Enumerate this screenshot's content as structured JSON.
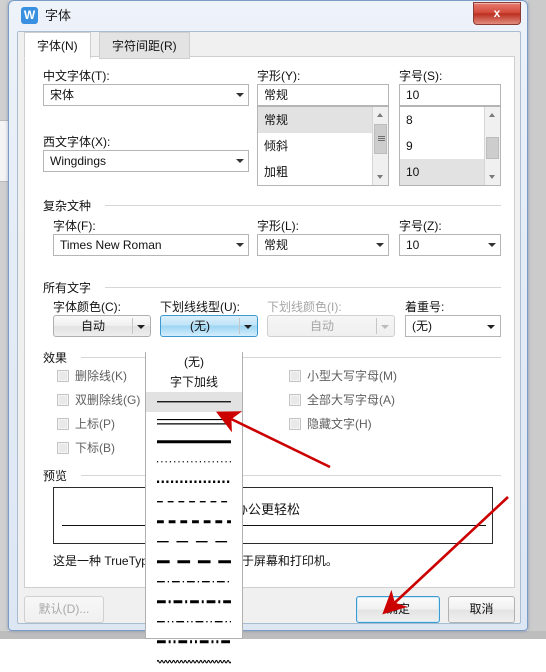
{
  "window": {
    "title": "字体",
    "icon": "wps-w-icon",
    "close_label": "x"
  },
  "tabs": [
    {
      "label": "字体(N)",
      "active": true
    },
    {
      "label": "字符间距(R)",
      "active": false
    }
  ],
  "latin_section": {
    "chinese_font": {
      "label": "中文字体(T):",
      "value": "宋体"
    },
    "western_font": {
      "label": "西文字体(X):",
      "value": "Wingdings"
    },
    "style": {
      "label": "字形(Y):",
      "value": "常规",
      "options": [
        "常规",
        "倾斜",
        "加粗"
      ],
      "selected": "常规"
    },
    "size": {
      "label": "字号(S):",
      "value": "10",
      "options": [
        "8",
        "9",
        "10"
      ],
      "selected": "10"
    }
  },
  "complex_section": {
    "title": "复杂文种",
    "font": {
      "label": "字体(F):",
      "value": "Times New Roman"
    },
    "style": {
      "label": "字形(L):",
      "value": "常规"
    },
    "size": {
      "label": "字号(Z):",
      "value": "10"
    }
  },
  "all_text_section": {
    "title": "所有文字",
    "font_color": {
      "label": "字体颜色(C):",
      "value": "自动",
      "disabled": false
    },
    "underline_style": {
      "label": "下划线线型(U):",
      "value": "(无)",
      "disabled": false,
      "active": true
    },
    "underline_color": {
      "label": "下划线颜色(I):",
      "value": "自动",
      "disabled": true
    },
    "emphasis_mark": {
      "label": "着重号:",
      "value": "(无)",
      "disabled": false
    }
  },
  "underline_dropdown": {
    "items": [
      {
        "kind": "text",
        "label": "(无)",
        "selected": false
      },
      {
        "kind": "text",
        "label": "字下加线",
        "selected": false
      },
      {
        "kind": "line",
        "style": "single",
        "selected": true
      },
      {
        "kind": "line",
        "style": "double",
        "selected": false
      },
      {
        "kind": "line",
        "style": "thick",
        "selected": false
      },
      {
        "kind": "line",
        "style": "dotted",
        "selected": false
      },
      {
        "kind": "line",
        "style": "dotted-thick",
        "selected": false
      },
      {
        "kind": "line",
        "style": "dashed",
        "selected": false
      },
      {
        "kind": "line",
        "style": "dashed-thick",
        "selected": false
      },
      {
        "kind": "line",
        "style": "long-dash",
        "selected": false
      },
      {
        "kind": "line",
        "style": "long-dash-thick",
        "selected": false
      },
      {
        "kind": "line",
        "style": "dash-dot",
        "selected": false
      },
      {
        "kind": "line",
        "style": "dash-dot-thick",
        "selected": false
      },
      {
        "kind": "line",
        "style": "dash-dot-dot",
        "selected": false
      },
      {
        "kind": "line",
        "style": "dash-dot-dot-thick",
        "selected": false
      },
      {
        "kind": "line",
        "style": "wave",
        "selected": false
      }
    ]
  },
  "effects_section": {
    "title": "效果",
    "left_items": [
      {
        "label": "删除线(K)",
        "checked": false
      },
      {
        "label": "双删除线(G)",
        "checked": false
      },
      {
        "label": "上标(P)",
        "checked": false
      },
      {
        "label": "下标(B)",
        "checked": false
      }
    ],
    "right_items": [
      {
        "label": "小型大写字母(M)",
        "checked": false
      },
      {
        "label": "全部大写字母(A)",
        "checked": false
      },
      {
        "label": "隐藏文字(H)",
        "checked": false
      }
    ]
  },
  "preview_section": {
    "title": "预览",
    "sample_text": "让办公更轻松",
    "note": "这是一种 TrueType 字体，同时适用于屏幕和打印机。"
  },
  "footer": {
    "default_button": "默认(D)...",
    "ok_button": "确定",
    "cancel_button": "取消"
  },
  "annotations": {
    "accent_color": "#cc0000",
    "arrow_to_single_underline": "arrow-icon",
    "arrow_to_ok_button": "arrow-icon"
  }
}
